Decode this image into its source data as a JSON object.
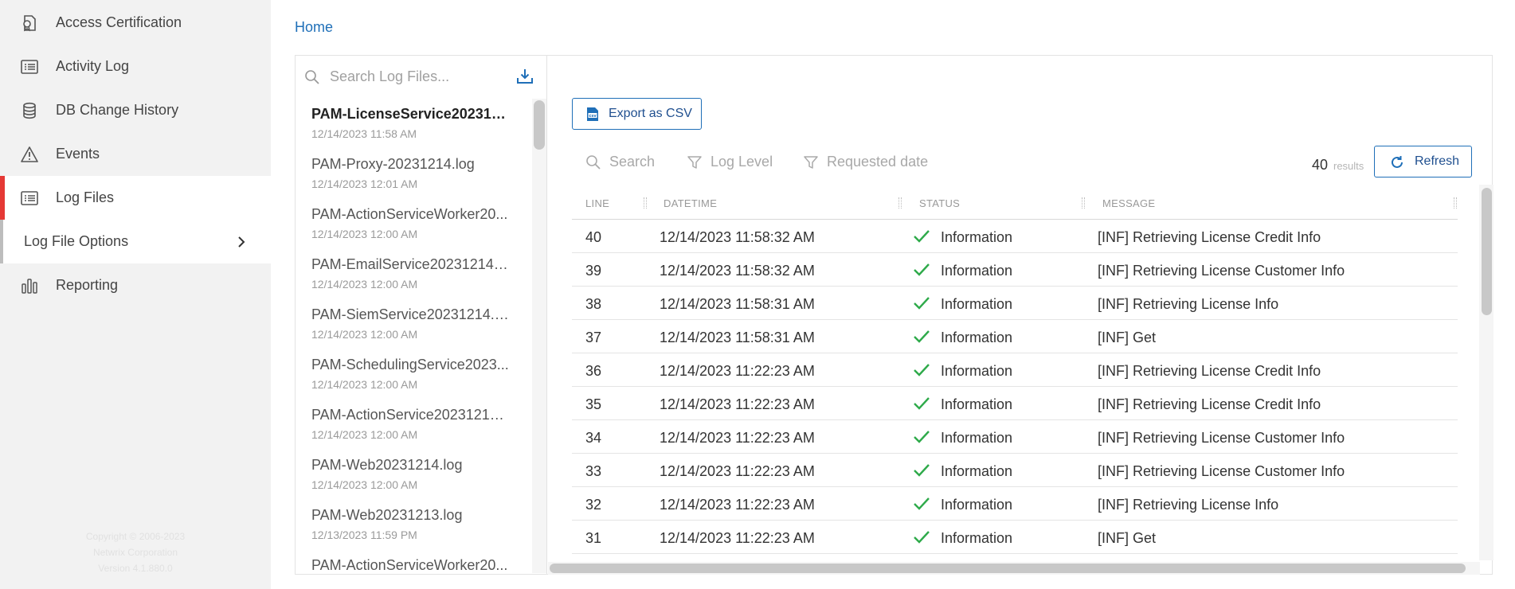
{
  "sidebar": {
    "items": [
      {
        "label": "Access Certification",
        "icon": "certificate-icon"
      },
      {
        "label": "Activity Log",
        "icon": "list-icon"
      },
      {
        "label": "DB Change History",
        "icon": "database-icon"
      },
      {
        "label": "Events",
        "icon": "warning-icon"
      },
      {
        "label": "Log Files",
        "icon": "list-icon"
      },
      {
        "label": "Log File Options",
        "icon": "chevron-right-icon"
      },
      {
        "label": "Reporting",
        "icon": "bar-chart-icon"
      }
    ],
    "copyright": [
      "Copyright © 2006-2023",
      "Netwrix Corporation",
      "Version 4.1.880.0"
    ]
  },
  "breadcrumb": {
    "home": "Home"
  },
  "file_search": {
    "placeholder": "Search Log Files..."
  },
  "files": [
    {
      "name": "PAM-LicenseService2023121...",
      "date": "12/14/2023 11:58 AM"
    },
    {
      "name": "PAM-Proxy-20231214.log",
      "date": "12/14/2023 12:01 AM"
    },
    {
      "name": "PAM-ActionServiceWorker20...",
      "date": "12/14/2023 12:00 AM"
    },
    {
      "name": "PAM-EmailService20231214.l...",
      "date": "12/14/2023 12:00 AM"
    },
    {
      "name": "PAM-SiemService20231214.log",
      "date": "12/14/2023 12:00 AM"
    },
    {
      "name": "PAM-SchedulingService2023...",
      "date": "12/14/2023 12:00 AM"
    },
    {
      "name": "PAM-ActionService20231214....",
      "date": "12/14/2023 12:00 AM"
    },
    {
      "name": "PAM-Web20231214.log",
      "date": "12/14/2023 12:00 AM"
    },
    {
      "name": "PAM-Web20231213.log",
      "date": "12/13/2023 11:59 PM"
    },
    {
      "name": "PAM-ActionServiceWorker20...",
      "date": ""
    }
  ],
  "toolbar": {
    "export_label": "Export as CSV",
    "search_label": "Search",
    "log_level_label": "Log Level",
    "requested_date_label": "Requested date",
    "results_count": "40",
    "results_label": "results",
    "refresh_label": "Refresh"
  },
  "table": {
    "columns": [
      "LINE",
      "DATETIME",
      "STATUS",
      "MESSAGE"
    ],
    "rows": [
      {
        "line": "40",
        "datetime": "12/14/2023 11:58:32 AM",
        "status": "Information",
        "message": "[INF] Retrieving License Credit Info"
      },
      {
        "line": "39",
        "datetime": "12/14/2023 11:58:32 AM",
        "status": "Information",
        "message": "[INF] Retrieving License Customer Info"
      },
      {
        "line": "38",
        "datetime": "12/14/2023 11:58:31 AM",
        "status": "Information",
        "message": "[INF] Retrieving License Info"
      },
      {
        "line": "37",
        "datetime": "12/14/2023 11:58:31 AM",
        "status": "Information",
        "message": "[INF] Get"
      },
      {
        "line": "36",
        "datetime": "12/14/2023 11:22:23 AM",
        "status": "Information",
        "message": "[INF] Retrieving License Credit Info"
      },
      {
        "line": "35",
        "datetime": "12/14/2023 11:22:23 AM",
        "status": "Information",
        "message": "[INF] Retrieving License Credit Info"
      },
      {
        "line": "34",
        "datetime": "12/14/2023 11:22:23 AM",
        "status": "Information",
        "message": "[INF] Retrieving License Customer Info"
      },
      {
        "line": "33",
        "datetime": "12/14/2023 11:22:23 AM",
        "status": "Information",
        "message": "[INF] Retrieving License Customer Info"
      },
      {
        "line": "32",
        "datetime": "12/14/2023 11:22:23 AM",
        "status": "Information",
        "message": "[INF] Retrieving License Info"
      },
      {
        "line": "31",
        "datetime": "12/14/2023 11:22:23 AM",
        "status": "Information",
        "message": "[INF] Get"
      }
    ]
  },
  "colors": {
    "accent": "#1f6fb8",
    "active_marker": "#e53935",
    "success": "#2eaa4a"
  }
}
